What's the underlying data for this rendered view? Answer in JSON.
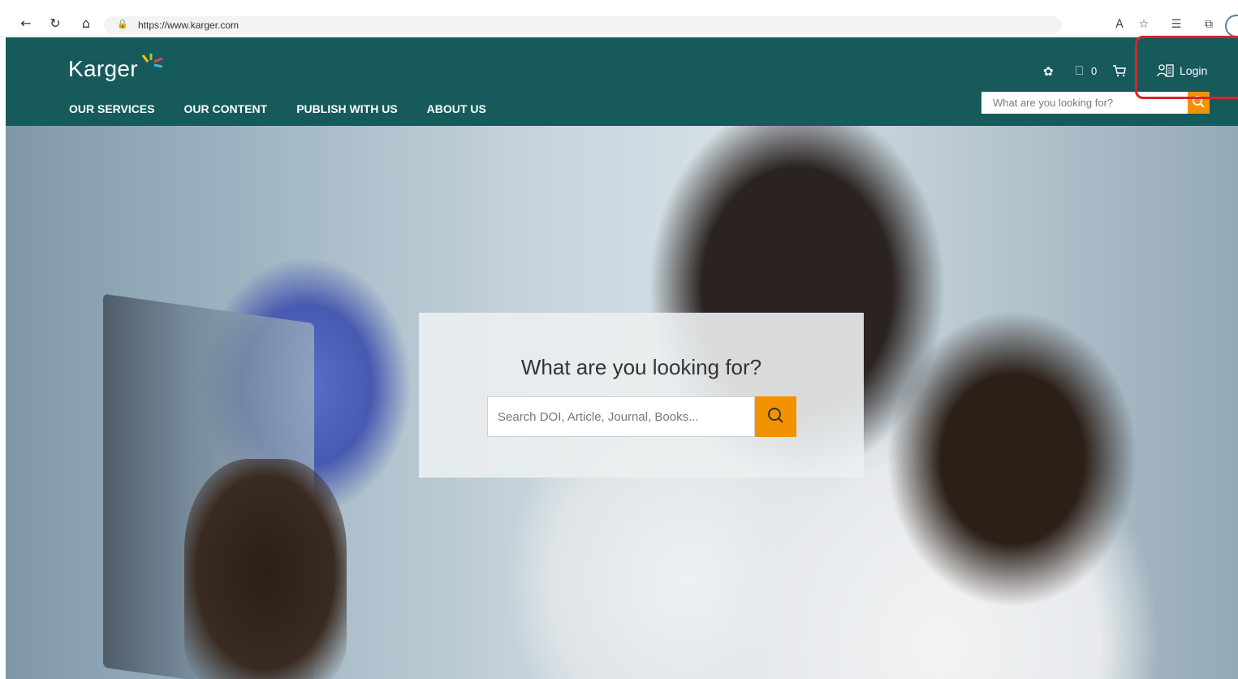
{
  "browser": {
    "url": "https://www.karger.com"
  },
  "header": {
    "logo_text": "Karger",
    "nav": [
      {
        "label": "OUR SERVICES"
      },
      {
        "label": "OUR CONTENT"
      },
      {
        "label": "PUBLISH WITH US"
      },
      {
        "label": "ABOUT US"
      }
    ],
    "bookmark_count": "0",
    "login_label": "Login",
    "search_placeholder": "What are you looking for?"
  },
  "hero": {
    "title": "What are you looking for?",
    "search_placeholder": "Search DOI, Article, Journal, Books..."
  },
  "colors": {
    "brand_teal": "#165a5c",
    "accent_orange": "#f39200",
    "highlight_red": "#d9232d"
  }
}
